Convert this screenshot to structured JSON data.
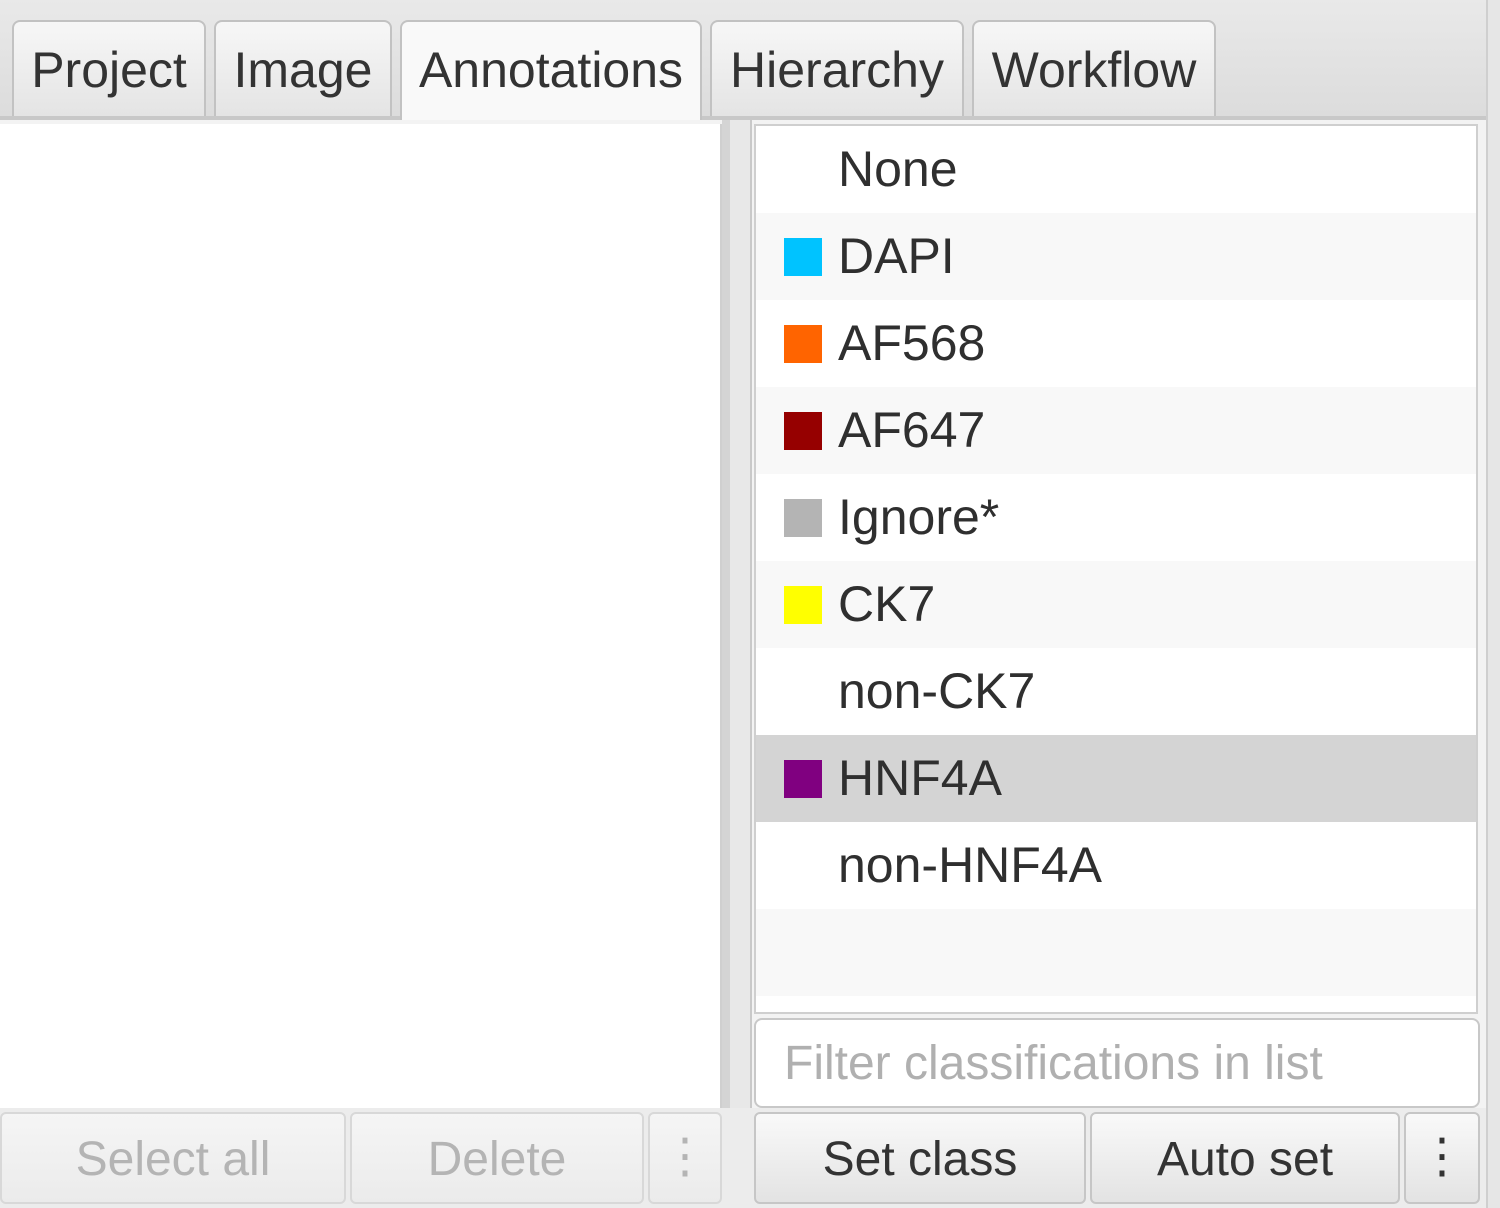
{
  "tabs": [
    {
      "label": "Project",
      "selected": false
    },
    {
      "label": "Image",
      "selected": false
    },
    {
      "label": "Annotations",
      "selected": true
    },
    {
      "label": "Hierarchy",
      "selected": false
    },
    {
      "label": "Workflow",
      "selected": false
    }
  ],
  "annotations_panel": {
    "select_all_label": "Select all",
    "delete_label": "Delete",
    "more_label": "⋮"
  },
  "classifications": [
    {
      "name": "None",
      "color": null
    },
    {
      "name": "DAPI",
      "color": "#00c3ff"
    },
    {
      "name": "AF568",
      "color": "#ff6400"
    },
    {
      "name": "AF647",
      "color": "#960000"
    },
    {
      "name": "Ignore*",
      "color": "#b4b4b4"
    },
    {
      "name": "CK7",
      "color": "#ffff00"
    },
    {
      "name": "non-CK7",
      "color": null
    },
    {
      "name": "HNF4A",
      "color": "#800080",
      "selected": true
    },
    {
      "name": "non-HNF4A",
      "color": null
    }
  ],
  "classification_panel": {
    "filter_placeholder": "Filter classifications in list",
    "set_class_label": "Set class",
    "auto_set_label": "Auto set",
    "more_label": "⋮"
  }
}
